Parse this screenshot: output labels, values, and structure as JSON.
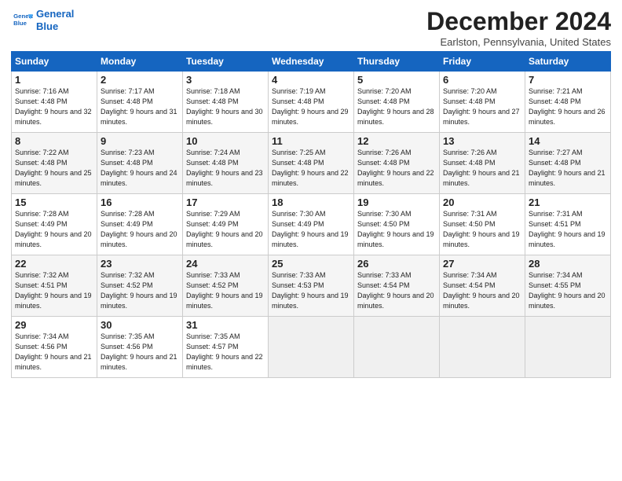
{
  "logo": {
    "line1": "General",
    "line2": "Blue"
  },
  "title": "December 2024",
  "location": "Earlston, Pennsylvania, United States",
  "days_of_week": [
    "Sunday",
    "Monday",
    "Tuesday",
    "Wednesday",
    "Thursday",
    "Friday",
    "Saturday"
  ],
  "weeks": [
    [
      {
        "num": "1",
        "sunrise": "7:16 AM",
        "sunset": "4:48 PM",
        "daylight": "9 hours and 32 minutes."
      },
      {
        "num": "2",
        "sunrise": "7:17 AM",
        "sunset": "4:48 PM",
        "daylight": "9 hours and 31 minutes."
      },
      {
        "num": "3",
        "sunrise": "7:18 AM",
        "sunset": "4:48 PM",
        "daylight": "9 hours and 30 minutes."
      },
      {
        "num": "4",
        "sunrise": "7:19 AM",
        "sunset": "4:48 PM",
        "daylight": "9 hours and 29 minutes."
      },
      {
        "num": "5",
        "sunrise": "7:20 AM",
        "sunset": "4:48 PM",
        "daylight": "9 hours and 28 minutes."
      },
      {
        "num": "6",
        "sunrise": "7:20 AM",
        "sunset": "4:48 PM",
        "daylight": "9 hours and 27 minutes."
      },
      {
        "num": "7",
        "sunrise": "7:21 AM",
        "sunset": "4:48 PM",
        "daylight": "9 hours and 26 minutes."
      }
    ],
    [
      {
        "num": "8",
        "sunrise": "7:22 AM",
        "sunset": "4:48 PM",
        "daylight": "9 hours and 25 minutes."
      },
      {
        "num": "9",
        "sunrise": "7:23 AM",
        "sunset": "4:48 PM",
        "daylight": "9 hours and 24 minutes."
      },
      {
        "num": "10",
        "sunrise": "7:24 AM",
        "sunset": "4:48 PM",
        "daylight": "9 hours and 23 minutes."
      },
      {
        "num": "11",
        "sunrise": "7:25 AM",
        "sunset": "4:48 PM",
        "daylight": "9 hours and 22 minutes."
      },
      {
        "num": "12",
        "sunrise": "7:26 AM",
        "sunset": "4:48 PM",
        "daylight": "9 hours and 22 minutes."
      },
      {
        "num": "13",
        "sunrise": "7:26 AM",
        "sunset": "4:48 PM",
        "daylight": "9 hours and 21 minutes."
      },
      {
        "num": "14",
        "sunrise": "7:27 AM",
        "sunset": "4:48 PM",
        "daylight": "9 hours and 21 minutes."
      }
    ],
    [
      {
        "num": "15",
        "sunrise": "7:28 AM",
        "sunset": "4:49 PM",
        "daylight": "9 hours and 20 minutes."
      },
      {
        "num": "16",
        "sunrise": "7:28 AM",
        "sunset": "4:49 PM",
        "daylight": "9 hours and 20 minutes."
      },
      {
        "num": "17",
        "sunrise": "7:29 AM",
        "sunset": "4:49 PM",
        "daylight": "9 hours and 20 minutes."
      },
      {
        "num": "18",
        "sunrise": "7:30 AM",
        "sunset": "4:49 PM",
        "daylight": "9 hours and 19 minutes."
      },
      {
        "num": "19",
        "sunrise": "7:30 AM",
        "sunset": "4:50 PM",
        "daylight": "9 hours and 19 minutes."
      },
      {
        "num": "20",
        "sunrise": "7:31 AM",
        "sunset": "4:50 PM",
        "daylight": "9 hours and 19 minutes."
      },
      {
        "num": "21",
        "sunrise": "7:31 AM",
        "sunset": "4:51 PM",
        "daylight": "9 hours and 19 minutes."
      }
    ],
    [
      {
        "num": "22",
        "sunrise": "7:32 AM",
        "sunset": "4:51 PM",
        "daylight": "9 hours and 19 minutes."
      },
      {
        "num": "23",
        "sunrise": "7:32 AM",
        "sunset": "4:52 PM",
        "daylight": "9 hours and 19 minutes."
      },
      {
        "num": "24",
        "sunrise": "7:33 AM",
        "sunset": "4:52 PM",
        "daylight": "9 hours and 19 minutes."
      },
      {
        "num": "25",
        "sunrise": "7:33 AM",
        "sunset": "4:53 PM",
        "daylight": "9 hours and 19 minutes."
      },
      {
        "num": "26",
        "sunrise": "7:33 AM",
        "sunset": "4:54 PM",
        "daylight": "9 hours and 20 minutes."
      },
      {
        "num": "27",
        "sunrise": "7:34 AM",
        "sunset": "4:54 PM",
        "daylight": "9 hours and 20 minutes."
      },
      {
        "num": "28",
        "sunrise": "7:34 AM",
        "sunset": "4:55 PM",
        "daylight": "9 hours and 20 minutes."
      }
    ],
    [
      {
        "num": "29",
        "sunrise": "7:34 AM",
        "sunset": "4:56 PM",
        "daylight": "9 hours and 21 minutes."
      },
      {
        "num": "30",
        "sunrise": "7:35 AM",
        "sunset": "4:56 PM",
        "daylight": "9 hours and 21 minutes."
      },
      {
        "num": "31",
        "sunrise": "7:35 AM",
        "sunset": "4:57 PM",
        "daylight": "9 hours and 22 minutes."
      },
      null,
      null,
      null,
      null
    ]
  ],
  "labels": {
    "sunrise": "Sunrise:",
    "sunset": "Sunset:",
    "daylight": "Daylight:"
  }
}
